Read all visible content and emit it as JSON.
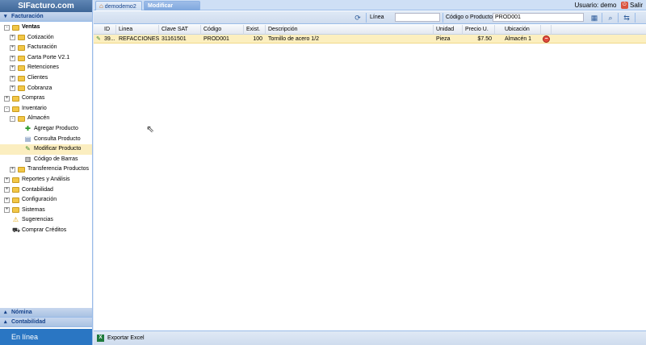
{
  "sidebar": {
    "brand": "SIFacturo.com",
    "section_title": "Facturación",
    "tree": [
      {
        "label": "Ventas",
        "level": 0,
        "type": "folder",
        "exp": "-",
        "bold": true
      },
      {
        "label": "Cotización",
        "level": 1,
        "type": "folder",
        "exp": "+"
      },
      {
        "label": "Facturación",
        "level": 1,
        "type": "folder",
        "exp": "+"
      },
      {
        "label": "Carta Porte V2.1",
        "level": 1,
        "type": "folder",
        "exp": "+"
      },
      {
        "label": "Retenciones",
        "level": 1,
        "type": "folder",
        "exp": "+"
      },
      {
        "label": "Clientes",
        "level": 1,
        "type": "folder",
        "exp": "+"
      },
      {
        "label": "Cobranza",
        "level": 1,
        "type": "folder",
        "exp": "+"
      },
      {
        "label": "Compras",
        "level": 0,
        "type": "folder",
        "exp": "+"
      },
      {
        "label": "Inventario",
        "level": 0,
        "type": "folder",
        "exp": "-"
      },
      {
        "label": "Almacén",
        "level": 1,
        "type": "folder",
        "exp": "-"
      },
      {
        "label": "Agregar Producto",
        "level": 2,
        "type": "plus"
      },
      {
        "label": "Consulta Producto",
        "level": 2,
        "type": "doc"
      },
      {
        "label": "Modificar Producto",
        "level": 2,
        "type": "pencil",
        "selected": true
      },
      {
        "label": "Código de Barras",
        "level": 2,
        "type": "barcode"
      },
      {
        "label": "Transferencia Productos",
        "level": 1,
        "type": "folder",
        "exp": "+"
      },
      {
        "label": "Reportes y Análisis",
        "level": 0,
        "type": "folder",
        "exp": "+"
      },
      {
        "label": "Contabilidad",
        "level": 0,
        "type": "folder",
        "exp": "+"
      },
      {
        "label": "Configuración",
        "level": 0,
        "type": "folder",
        "exp": "+"
      },
      {
        "label": "Sistemas",
        "level": 0,
        "type": "folder",
        "exp": "+"
      },
      {
        "label": "Sugerencias",
        "level": 0,
        "type": "warn"
      },
      {
        "label": "Comprar Créditos",
        "level": 0,
        "type": "cart"
      }
    ],
    "bottom_panels": [
      "Nómina",
      "Contabilidad"
    ],
    "status": "En línea"
  },
  "tabs": [
    {
      "label": "demodemo2",
      "active": false
    },
    {
      "label": "Modificar Producto",
      "active": true
    }
  ],
  "user": {
    "label": "Usuario: demo",
    "logout": "Salir"
  },
  "toolbar": {
    "linea_label": "Línea",
    "linea_value": "",
    "codigo_label": "Código o Producto",
    "codigo_value": "PROD001"
  },
  "grid": {
    "columns": [
      "ID",
      "Linea",
      "Clave SAT",
      "Código",
      "Exist.",
      "Descripción",
      "Unidad",
      "Precio U.",
      "Ubicación"
    ],
    "rows": [
      {
        "id": "39...",
        "linea": "REFACCIONES",
        "clave_sat": "31161501",
        "codigo": "PROD001",
        "exist": "100",
        "descripcion": "Tornillo de acero 1/2",
        "unidad": "Pieza",
        "precio": "$7.50",
        "ubicacion": "Almacén 1"
      }
    ]
  },
  "footer": {
    "export_label": "Exportar Excel"
  }
}
